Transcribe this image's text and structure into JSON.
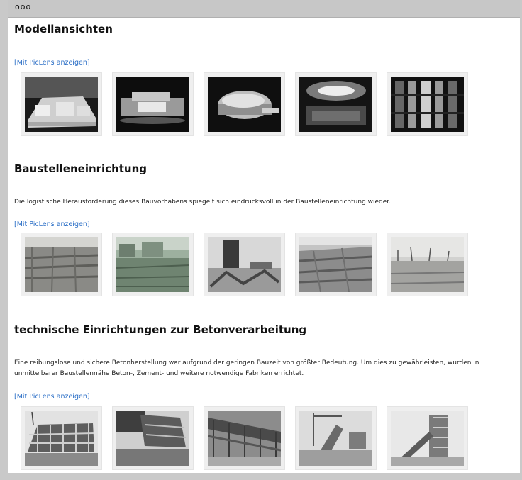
{
  "window": {
    "dots": "ooo"
  },
  "sections": [
    {
      "title": "Modellansichten",
      "description": "",
      "link": "[Mit PicLens anzeigen]",
      "thumbs": [
        "model-building-photo",
        "model-building-photo",
        "model-building-photo",
        "model-interior-photo",
        "model-facade-photo"
      ]
    },
    {
      "title": "Baustelleneinrichtung",
      "description": "Die logistische Herausforderung dieses Bauvorhabens spiegelt sich eindrucksvoll in der Baustelleneinrichtung wieder.",
      "link": "[Mit PicLens anzeigen]",
      "thumbs": [
        "construction-site-photo",
        "construction-site-photo",
        "construction-site-photo",
        "construction-site-photo",
        "construction-site-photo"
      ]
    },
    {
      "title": "technische Einrichtungen zur Betonverarbeitung",
      "description": "Eine reibungslose und sichere Betonherstellung war aufgrund der geringen Bauzeit von größter Bedeutung. Um dies zu gewährleisten, wurden in unmittelbarer Baustellennähe Beton-, Zement- und weitere notwendige Fabriken errichtet.",
      "link": "[Mit PicLens anzeigen]",
      "thumbs": [
        "concrete-plant-photo",
        "concrete-plant-photo",
        "concrete-plant-photo",
        "concrete-plant-photo",
        "concrete-plant-photo"
      ]
    }
  ]
}
